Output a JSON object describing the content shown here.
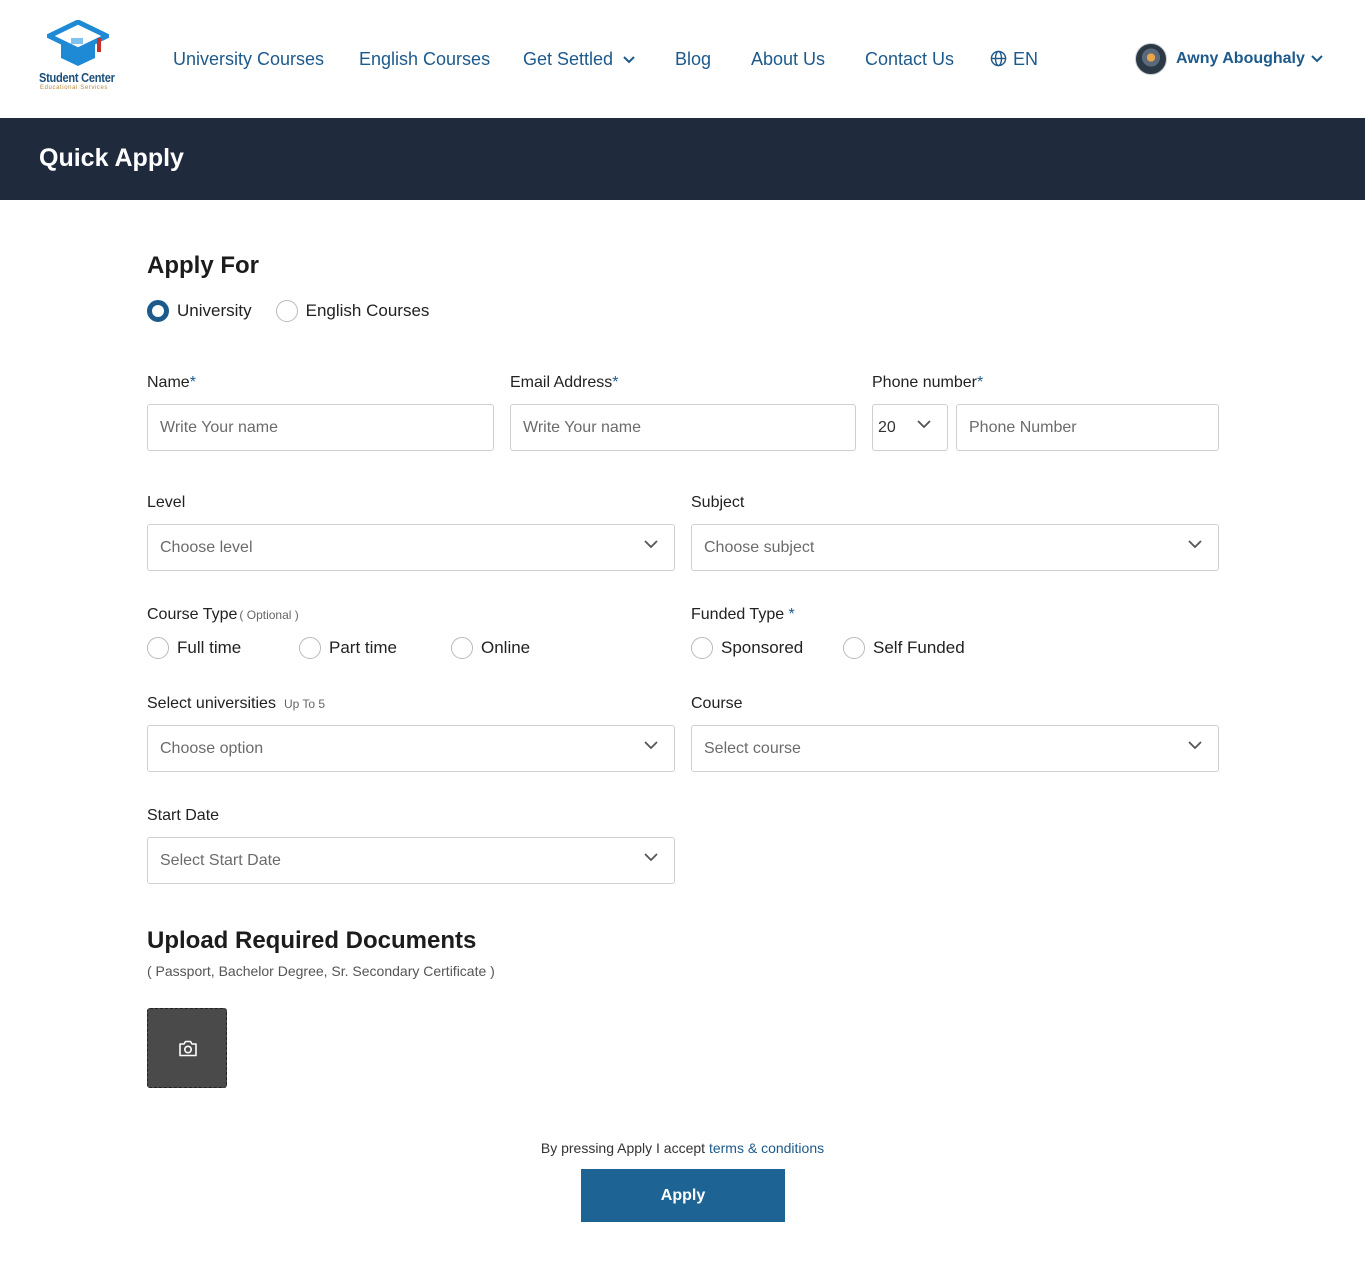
{
  "brand": {
    "name": "Student Center",
    "tagline": "Educational Services"
  },
  "nav": {
    "items": [
      "University Courses",
      "English Courses",
      "Get Settled",
      "Blog",
      "About Us",
      "Contact Us"
    ],
    "language": "EN",
    "user_name": "Awny Aboughaly"
  },
  "page_title": "Quick Apply",
  "apply_for": {
    "heading": "Apply For",
    "options": [
      "University",
      "English Courses"
    ],
    "selected": "University"
  },
  "fields": {
    "name": {
      "label": "Name",
      "required": "*",
      "placeholder": "Write Your name"
    },
    "email": {
      "label": "Email Address",
      "required": "*",
      "placeholder": "Write Your name"
    },
    "phone": {
      "label": "Phone number",
      "required": "*",
      "code": "20",
      "placeholder": "Phone Number"
    },
    "level": {
      "label": "Level",
      "placeholder": "Choose level"
    },
    "subject": {
      "label": "Subject",
      "placeholder": "Choose subject"
    },
    "course_type": {
      "label": "Course Type",
      "note": "( Optional )",
      "options": [
        "Full time",
        "Part time",
        "Online"
      ]
    },
    "funded_type": {
      "label": "Funded Type",
      "required": " *",
      "options": [
        "Sponsored",
        "Self Funded"
      ]
    },
    "universities": {
      "label": "Select universities",
      "note": "Up To 5",
      "placeholder": "Choose option"
    },
    "course": {
      "label": "Course",
      "placeholder": "Select course"
    },
    "start_date": {
      "label": "Start Date",
      "placeholder": "Select Start Date"
    }
  },
  "upload": {
    "heading": "Upload Required Documents",
    "note": "( Passport, Bachelor Degree, Sr. Secondary Certificate )"
  },
  "footer": {
    "terms_prefix": "By pressing Apply I accept ",
    "terms_link": "terms & conditions",
    "apply_label": "Apply"
  },
  "colors": {
    "primary": "#1d5a8c",
    "band": "#1f2a3d",
    "button": "#1d6494"
  }
}
